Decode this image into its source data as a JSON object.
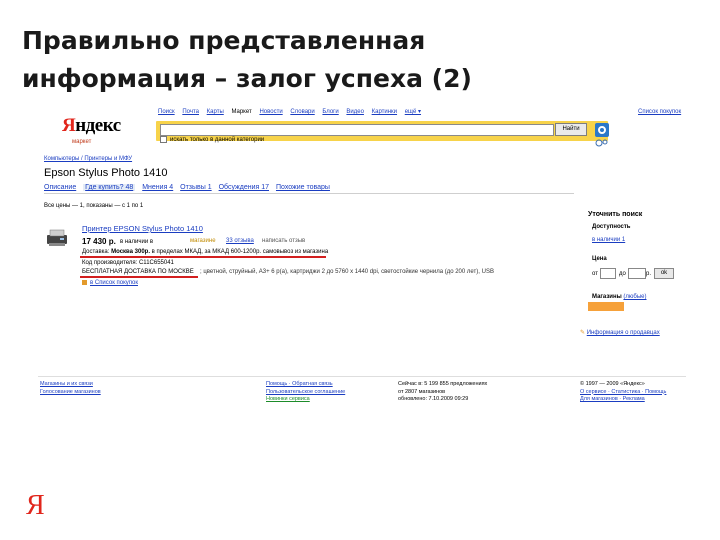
{
  "slide": {
    "title_line1": "Правильно представленная",
    "title_line2": "информация – залог успеха (2)",
    "corner_logo": "Я"
  },
  "header": {
    "logo_red": "Я",
    "logo_rest": "ндекс",
    "logo_sub": "маркет",
    "nav": [
      "Поиск",
      "Почта",
      "Карты",
      "Маркет",
      "Новости",
      "Словари",
      "Блоги",
      "Видео",
      "Картинки",
      "ещё ▾"
    ],
    "right_link": "Список покупок",
    "search_button": "Найти",
    "checkbox_label": "искать только в данной категории"
  },
  "product": {
    "breadcrumb": "Компьютеры / Принтеры и МФУ",
    "title": "Epson Stylus Photo 1410",
    "tabs": [
      {
        "label": "Описание",
        "active": false
      },
      {
        "label": "Где купить? 48",
        "active": true
      },
      {
        "label": "Мнения 4",
        "active": false
      },
      {
        "label": "Отзывы 1",
        "active": false
      },
      {
        "label": "Обсуждения 17",
        "active": false
      },
      {
        "label": "Похожие товары",
        "active": false
      }
    ],
    "all_prices": "Все цены — 1, показаны — с 1 по 1"
  },
  "offer": {
    "title": "Принтер EPSON Stylus Photo 1410",
    "price": "17 430 р.",
    "instock": "в наличии в",
    "shop": "магазине",
    "rating": "33 отзыва",
    "read_reviews": "написать отзыв",
    "delivery_prefix": "Доставка:",
    "delivery_bold": "Москва 300р.",
    "delivery_rest": "в пределах МКАД, за МКАД 600-1200р. самовывоз из магазина",
    "code": "Код производителя: С11С655041",
    "free_delivery": "БЕСПЛАТНАЯ ДОСТАВКА ПО МОСКВЕ",
    "desc": "; цветной, струйный, А3+ 6 p(a), картриджи 2 до 5760 x 1440 dpi, светостойкие чернила (до 200 лет), USB",
    "compare": "в Список покупок"
  },
  "sidebar": {
    "heading": "Уточнить поиск",
    "availability_label": "Доступность",
    "availability_value": "в наличии   1",
    "price_label": "Цена",
    "from": "от",
    "to": "до",
    "currency": "р.",
    "ok": "ok",
    "shops_label": "Магазины",
    "shops_link": "(любые)",
    "pricebook": "Информация о продавцах"
  },
  "footer": {
    "col1": [
      "Магазины и их связи",
      "Голосование магазинов"
    ],
    "col2": [
      "Помощь · Обратная связь",
      "Пользовательское соглашение",
      "Новинки сервиса"
    ],
    "col3": [
      "Сейчас в: 5 199 855 предложениях",
      "от 2807 магазинов",
      "обновлено: 7.10.2009 09:29"
    ],
    "col4": [
      "© 1997 — 2009 «Яндекс»",
      "О сервисе · Статистика · Помощь",
      "Для магазинов · Реклама"
    ]
  },
  "colors": {
    "accent_red": "#d21f1f",
    "yandex_red": "#e1261c",
    "link_blue": "#1a3dc1",
    "search_yellow": "#f7d34a",
    "orange": "#f6a13a"
  }
}
